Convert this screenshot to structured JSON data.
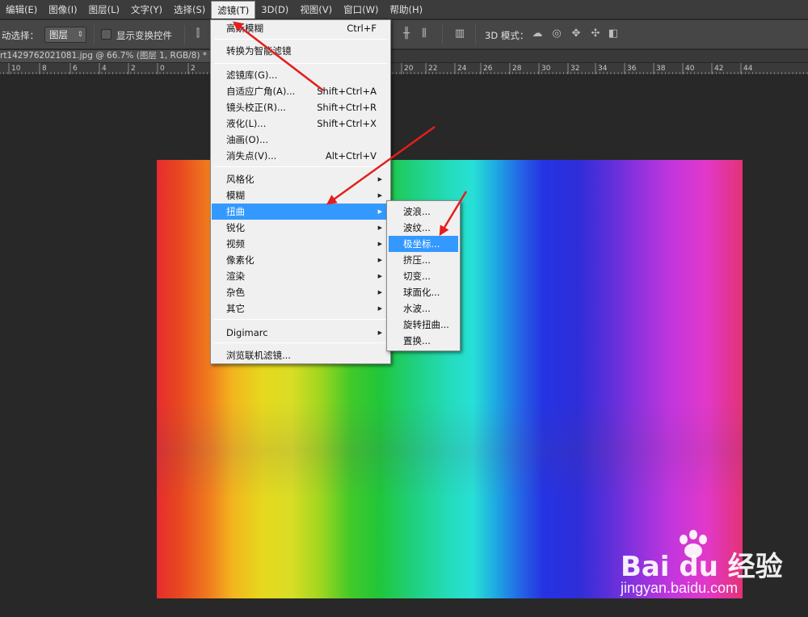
{
  "menubar": {
    "items": [
      {
        "label": "编辑(E)",
        "active": false
      },
      {
        "label": "图像(I)",
        "active": false
      },
      {
        "label": "图层(L)",
        "active": false
      },
      {
        "label": "文字(Y)",
        "active": false
      },
      {
        "label": "选择(S)",
        "active": false
      },
      {
        "label": "滤镜(T)",
        "active": true
      },
      {
        "label": "3D(D)",
        "active": false
      },
      {
        "label": "视图(V)",
        "active": false
      },
      {
        "label": "窗口(W)",
        "active": false
      },
      {
        "label": "帮助(H)",
        "active": false
      }
    ]
  },
  "options_bar": {
    "auto_select_label": "动选择：",
    "auto_select_value": "图层",
    "show_transform_label": "显示变换控件",
    "mode_3d_label": "3D 模式："
  },
  "document": {
    "tab_title": "rt1429762021081.jpg @ 66.7% (图层 1, RGB/8) *"
  },
  "ruler": {
    "labels": [
      "10",
      "8",
      "6",
      "4",
      "2",
      "0",
      "2",
      "20",
      "22",
      "24",
      "26",
      "28",
      "30",
      "32",
      "34",
      "36",
      "38",
      "40",
      "42",
      "44"
    ]
  },
  "filter_menu": {
    "items": [
      {
        "label": "高斯模糊",
        "shortcut": "Ctrl+F",
        "submenu": false,
        "highlighted": false
      },
      {
        "label": "转换为智能滤镜",
        "shortcut": "",
        "submenu": false,
        "highlighted": false
      },
      {
        "label": "滤镜库(G)...",
        "shortcut": "",
        "submenu": false,
        "highlighted": false
      },
      {
        "label": "自适应广角(A)...",
        "shortcut": "Shift+Ctrl+A",
        "submenu": false,
        "highlighted": false
      },
      {
        "label": "镜头校正(R)...",
        "shortcut": "Shift+Ctrl+R",
        "submenu": false,
        "highlighted": false
      },
      {
        "label": "液化(L)...",
        "shortcut": "Shift+Ctrl+X",
        "submenu": false,
        "highlighted": false
      },
      {
        "label": "油画(O)...",
        "shortcut": "",
        "submenu": false,
        "highlighted": false
      },
      {
        "label": "消失点(V)...",
        "shortcut": "Alt+Ctrl+V",
        "submenu": false,
        "highlighted": false
      },
      {
        "label": "风格化",
        "shortcut": "",
        "submenu": true,
        "highlighted": false
      },
      {
        "label": "模糊",
        "shortcut": "",
        "submenu": true,
        "highlighted": false
      },
      {
        "label": "扭曲",
        "shortcut": "",
        "submenu": true,
        "highlighted": true
      },
      {
        "label": "锐化",
        "shortcut": "",
        "submenu": true,
        "highlighted": false
      },
      {
        "label": "视频",
        "shortcut": "",
        "submenu": true,
        "highlighted": false
      },
      {
        "label": "像素化",
        "shortcut": "",
        "submenu": true,
        "highlighted": false
      },
      {
        "label": "渲染",
        "shortcut": "",
        "submenu": true,
        "highlighted": false
      },
      {
        "label": "杂色",
        "shortcut": "",
        "submenu": true,
        "highlighted": false
      },
      {
        "label": "其它",
        "shortcut": "",
        "submenu": true,
        "highlighted": false
      },
      {
        "label": "Digimarc",
        "shortcut": "",
        "submenu": true,
        "highlighted": false
      },
      {
        "label": "浏览联机滤镜...",
        "shortcut": "",
        "submenu": false,
        "highlighted": false
      }
    ]
  },
  "distort_submenu": {
    "items": [
      {
        "label": "波浪...",
        "highlighted": false
      },
      {
        "label": "波纹...",
        "highlighted": false
      },
      {
        "label": "极坐标...",
        "highlighted": true
      },
      {
        "label": "挤压...",
        "highlighted": false
      },
      {
        "label": "切变...",
        "highlighted": false
      },
      {
        "label": "球面化...",
        "highlighted": false
      },
      {
        "label": "水波...",
        "highlighted": false
      },
      {
        "label": "旋转扭曲...",
        "highlighted": false
      },
      {
        "label": "置换...",
        "highlighted": false
      }
    ]
  },
  "watermark": {
    "logo_text": "Bai du 经验",
    "url": "jingyan.baidu.com"
  },
  "colors": {
    "highlight": "#3399ff",
    "annotation_arrow": "#e41e1e"
  }
}
